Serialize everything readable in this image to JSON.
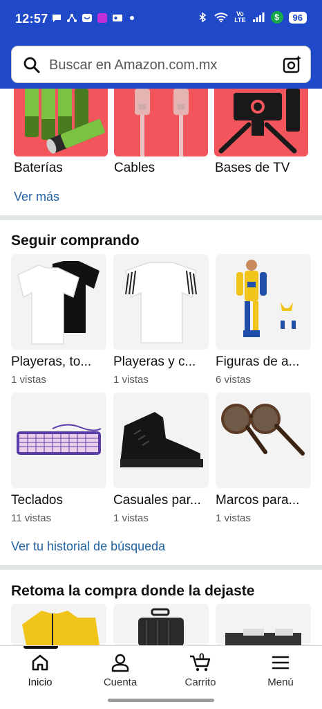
{
  "status_bar": {
    "time": "12:57",
    "volte_top": "Vo",
    "volte_bottom": "LTE",
    "battery": "96",
    "dollar": "$"
  },
  "search": {
    "placeholder": "Buscar en Amazon.com.mx"
  },
  "categories": [
    {
      "label": "Baterías"
    },
    {
      "label": "Cables"
    },
    {
      "label": "Bases de TV"
    }
  ],
  "ver_mas": "Ver más",
  "seguir_comprando": {
    "title": "Seguir comprando",
    "items": [
      {
        "name": "Playeras, to...",
        "views": "1 vistas"
      },
      {
        "name": "Playeras y c...",
        "views": "1 vistas"
      },
      {
        "name": "Figuras de a...",
        "views": "6 vistas"
      },
      {
        "name": "Teclados",
        "views": "11 vistas"
      },
      {
        "name": "Casuales par...",
        "views": "1 vistas"
      },
      {
        "name": "Marcos para...",
        "views": "1 vistas"
      }
    ],
    "history_link": "Ver tu historial de búsqueda"
  },
  "retoma": {
    "title": "Retoma la compra donde la dejaste"
  },
  "bottom_nav": {
    "items": [
      {
        "label": "Inicio",
        "icon": "home-icon",
        "active": true
      },
      {
        "label": "Cuenta",
        "icon": "account-icon",
        "active": false
      },
      {
        "label": "Carrito",
        "icon": "cart-icon",
        "active": false,
        "badge": "0"
      },
      {
        "label": "Menú",
        "icon": "menu-icon",
        "active": false
      }
    ]
  },
  "colors": {
    "header": "#1f49c8",
    "link": "#2162a1",
    "category_tile": "#f2555b"
  }
}
